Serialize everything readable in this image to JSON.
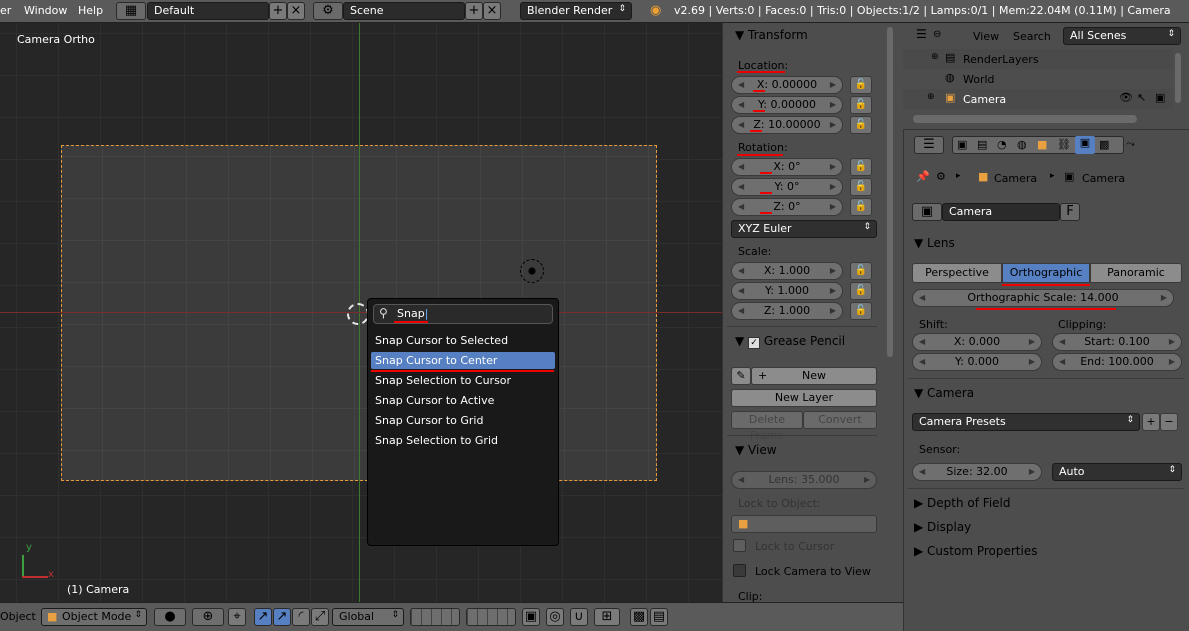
{
  "topbar": {
    "menu_file_partial": "er",
    "menu_window": "Window",
    "menu_help": "Help",
    "screen_layout": "Default",
    "scene": "Scene",
    "render_engine": "Blender Render",
    "stats": "v2.69 | Verts:0 | Faces:0 | Tris:0 | Objects:1/2 | Lamps:0/1 | Mem:22.04M (0.11M) | Camera"
  },
  "viewport": {
    "view_name": "Camera Ortho",
    "object_label": "(1) Camera",
    "axis_y": "y",
    "axis_x": "x"
  },
  "search_popup": {
    "query": "Snap",
    "items": [
      "Snap Cursor to Selected",
      "Snap Cursor to Center",
      "Snap Selection to Cursor",
      "Snap Cursor to Active",
      "Snap Cursor to Grid",
      "Snap Selection to Grid"
    ],
    "selected_index": 1
  },
  "bottombar": {
    "menu_object_partial": "Object",
    "mode": "Object Mode",
    "orientation": "Global"
  },
  "transform": {
    "title": "Transform",
    "location_label": "Location:",
    "loc_x": "X: 0.00000",
    "loc_y": "Y: 0.00000",
    "loc_z": "Z: 10.00000",
    "rotation_label": "Rotation:",
    "rot_x": "X: 0°",
    "rot_y": "Y: 0°",
    "rot_z": "Z: 0°",
    "rotation_mode": "XYZ Euler",
    "scale_label": "Scale:",
    "scale_x": "X: 1.000",
    "scale_y": "Y: 1.000",
    "scale_z": "Z: 1.000"
  },
  "grease_pencil": {
    "title": "Grease Pencil",
    "new": "New",
    "new_layer": "New Layer",
    "delete_frame": "Delete Frame",
    "convert": "Convert"
  },
  "view_panel": {
    "title": "View",
    "lens": "Lens: 35.000",
    "lock_to_object": "Lock to Object:",
    "lock_to_cursor": "Lock to Cursor",
    "lock_camera_to_view": "Lock Camera to View",
    "clip": "Clip:"
  },
  "outliner": {
    "view": "View",
    "search": "Search",
    "filter": "All Scenes",
    "rows": [
      "RenderLayers",
      "World",
      "Camera"
    ]
  },
  "properties": {
    "breadcrumb_object": "Camera",
    "breadcrumb_data": "Camera",
    "data_name": "Camera",
    "fake_user": "F",
    "lens_section": "Lens",
    "lens_types": [
      "Perspective",
      "Orthographic",
      "Panoramic"
    ],
    "active_lens": "Orthographic",
    "ortho_scale": "Orthographic Scale: 14.000",
    "shift_label": "Shift:",
    "shift_x": "X: 0.000",
    "shift_y": "Y: 0.000",
    "clipping_label": "Clipping:",
    "clip_start": "Start: 0.100",
    "clip_end": "End: 100.000",
    "camera_section": "Camera",
    "camera_presets": "Camera Presets",
    "sensor_label": "Sensor:",
    "sensor_size": "Size: 32.00",
    "sensor_fit": "Auto",
    "depth_of_field": "Depth of Field",
    "display": "Display",
    "custom_properties": "Custom Properties"
  },
  "colors": {
    "selection": "#5680c2",
    "annotation_red": "#e00000",
    "camera_frame": "#e79a3c"
  }
}
